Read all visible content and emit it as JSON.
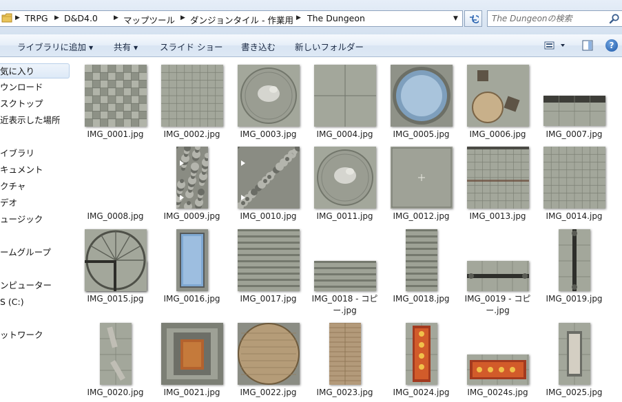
{
  "address_bar": {
    "crumbs": [
      "TRPG",
      "D&D4.0",
      "マップツール",
      "ダンジョンタイル - 作業用",
      "The Dungeon"
    ],
    "search_placeholder": "The Dungeonの検索"
  },
  "toolbar": {
    "library_add": "ライブラリに追加",
    "share": "共有",
    "slideshow": "スライド ショー",
    "burn": "書き込む",
    "new_folder": "新しいフォルダー",
    "help": "?"
  },
  "nav": {
    "items": [
      "気に入り",
      "ウンロード",
      "スクトップ",
      "近表示した場所",
      "イブラリ",
      "キュメント",
      "クチャ",
      "デオ",
      "ュージック",
      "ームグループ",
      "ンピューター",
      "S (C:)",
      "ットワーク"
    ]
  },
  "files": [
    {
      "name": "IMG_0001.jpg",
      "tile": "checker"
    },
    {
      "name": "IMG_0002.jpg",
      "tile": "grid"
    },
    {
      "name": "IMG_0003.jpg",
      "tile": "statue"
    },
    {
      "name": "IMG_0004.jpg",
      "tile": "plain4"
    },
    {
      "name": "IMG_0005.jpg",
      "tile": "pool"
    },
    {
      "name": "IMG_0006.jpg",
      "tile": "table"
    },
    {
      "name": "IMG_0007.jpg",
      "tile": "wallstrip"
    },
    {
      "name": "IMG_0008.jpg",
      "tile": "wallstrip2"
    },
    {
      "name": "IMG_0009.jpg",
      "tile": "rubble-narrow"
    },
    {
      "name": "IMG_0010.jpg",
      "tile": "rubble"
    },
    {
      "name": "IMG_0011.jpg",
      "tile": "statue2"
    },
    {
      "name": "IMG_0012.jpg",
      "tile": "plain"
    },
    {
      "name": "IMG_0013.jpg",
      "tile": "grid-wall"
    },
    {
      "name": "IMG_0014.jpg",
      "tile": "grid"
    },
    {
      "name": "IMG_0015.jpg",
      "tile": "stairs-round"
    },
    {
      "name": "IMG_0016.jpg",
      "tile": "water-narrow"
    },
    {
      "name": "IMG_0017.jpg",
      "tile": "stairs"
    },
    {
      "name": "IMG_0018 - コピー.jpg",
      "tile": "stairs-low"
    },
    {
      "name": "IMG_0018.jpg",
      "tile": "stairs-narrow"
    },
    {
      "name": "IMG_0019 - コピー.jpg",
      "tile": "pillar-h"
    },
    {
      "name": "IMG_0019.jpg",
      "tile": "pillar-v"
    },
    {
      "name": "IMG_0020.jpg",
      "tile": "pillars2"
    },
    {
      "name": "IMG_0021.jpg",
      "tile": "throne"
    },
    {
      "name": "IMG_0022.jpg",
      "tile": "round-wood"
    },
    {
      "name": "IMG_0023.jpg",
      "tile": "wood-narrow"
    },
    {
      "name": "IMG_0024.jpg",
      "tile": "rug-v"
    },
    {
      "name": "IMG_0024s.jpg",
      "tile": "rug-h"
    },
    {
      "name": "IMG_0025.jpg",
      "tile": "bones"
    }
  ]
}
